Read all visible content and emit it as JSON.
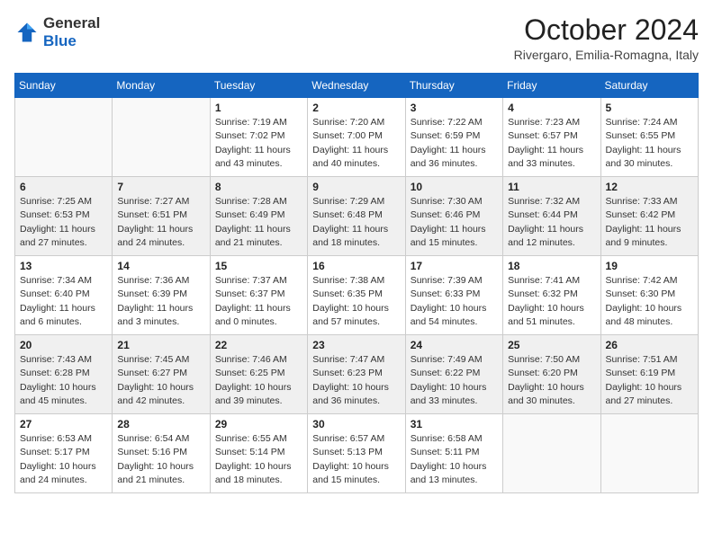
{
  "header": {
    "logo_general": "General",
    "logo_blue": "Blue",
    "month": "October 2024",
    "location": "Rivergaro, Emilia-Romagna, Italy"
  },
  "weekdays": [
    "Sunday",
    "Monday",
    "Tuesday",
    "Wednesday",
    "Thursday",
    "Friday",
    "Saturday"
  ],
  "weeks": [
    [
      {
        "day": "",
        "info": ""
      },
      {
        "day": "",
        "info": ""
      },
      {
        "day": "1",
        "info": "Sunrise: 7:19 AM\nSunset: 7:02 PM\nDaylight: 11 hours and 43 minutes."
      },
      {
        "day": "2",
        "info": "Sunrise: 7:20 AM\nSunset: 7:00 PM\nDaylight: 11 hours and 40 minutes."
      },
      {
        "day": "3",
        "info": "Sunrise: 7:22 AM\nSunset: 6:59 PM\nDaylight: 11 hours and 36 minutes."
      },
      {
        "day": "4",
        "info": "Sunrise: 7:23 AM\nSunset: 6:57 PM\nDaylight: 11 hours and 33 minutes."
      },
      {
        "day": "5",
        "info": "Sunrise: 7:24 AM\nSunset: 6:55 PM\nDaylight: 11 hours and 30 minutes."
      }
    ],
    [
      {
        "day": "6",
        "info": "Sunrise: 7:25 AM\nSunset: 6:53 PM\nDaylight: 11 hours and 27 minutes."
      },
      {
        "day": "7",
        "info": "Sunrise: 7:27 AM\nSunset: 6:51 PM\nDaylight: 11 hours and 24 minutes."
      },
      {
        "day": "8",
        "info": "Sunrise: 7:28 AM\nSunset: 6:49 PM\nDaylight: 11 hours and 21 minutes."
      },
      {
        "day": "9",
        "info": "Sunrise: 7:29 AM\nSunset: 6:48 PM\nDaylight: 11 hours and 18 minutes."
      },
      {
        "day": "10",
        "info": "Sunrise: 7:30 AM\nSunset: 6:46 PM\nDaylight: 11 hours and 15 minutes."
      },
      {
        "day": "11",
        "info": "Sunrise: 7:32 AM\nSunset: 6:44 PM\nDaylight: 11 hours and 12 minutes."
      },
      {
        "day": "12",
        "info": "Sunrise: 7:33 AM\nSunset: 6:42 PM\nDaylight: 11 hours and 9 minutes."
      }
    ],
    [
      {
        "day": "13",
        "info": "Sunrise: 7:34 AM\nSunset: 6:40 PM\nDaylight: 11 hours and 6 minutes."
      },
      {
        "day": "14",
        "info": "Sunrise: 7:36 AM\nSunset: 6:39 PM\nDaylight: 11 hours and 3 minutes."
      },
      {
        "day": "15",
        "info": "Sunrise: 7:37 AM\nSunset: 6:37 PM\nDaylight: 11 hours and 0 minutes."
      },
      {
        "day": "16",
        "info": "Sunrise: 7:38 AM\nSunset: 6:35 PM\nDaylight: 10 hours and 57 minutes."
      },
      {
        "day": "17",
        "info": "Sunrise: 7:39 AM\nSunset: 6:33 PM\nDaylight: 10 hours and 54 minutes."
      },
      {
        "day": "18",
        "info": "Sunrise: 7:41 AM\nSunset: 6:32 PM\nDaylight: 10 hours and 51 minutes."
      },
      {
        "day": "19",
        "info": "Sunrise: 7:42 AM\nSunset: 6:30 PM\nDaylight: 10 hours and 48 minutes."
      }
    ],
    [
      {
        "day": "20",
        "info": "Sunrise: 7:43 AM\nSunset: 6:28 PM\nDaylight: 10 hours and 45 minutes."
      },
      {
        "day": "21",
        "info": "Sunrise: 7:45 AM\nSunset: 6:27 PM\nDaylight: 10 hours and 42 minutes."
      },
      {
        "day": "22",
        "info": "Sunrise: 7:46 AM\nSunset: 6:25 PM\nDaylight: 10 hours and 39 minutes."
      },
      {
        "day": "23",
        "info": "Sunrise: 7:47 AM\nSunset: 6:23 PM\nDaylight: 10 hours and 36 minutes."
      },
      {
        "day": "24",
        "info": "Sunrise: 7:49 AM\nSunset: 6:22 PM\nDaylight: 10 hours and 33 minutes."
      },
      {
        "day": "25",
        "info": "Sunrise: 7:50 AM\nSunset: 6:20 PM\nDaylight: 10 hours and 30 minutes."
      },
      {
        "day": "26",
        "info": "Sunrise: 7:51 AM\nSunset: 6:19 PM\nDaylight: 10 hours and 27 minutes."
      }
    ],
    [
      {
        "day": "27",
        "info": "Sunrise: 6:53 AM\nSunset: 5:17 PM\nDaylight: 10 hours and 24 minutes."
      },
      {
        "day": "28",
        "info": "Sunrise: 6:54 AM\nSunset: 5:16 PM\nDaylight: 10 hours and 21 minutes."
      },
      {
        "day": "29",
        "info": "Sunrise: 6:55 AM\nSunset: 5:14 PM\nDaylight: 10 hours and 18 minutes."
      },
      {
        "day": "30",
        "info": "Sunrise: 6:57 AM\nSunset: 5:13 PM\nDaylight: 10 hours and 15 minutes."
      },
      {
        "day": "31",
        "info": "Sunrise: 6:58 AM\nSunset: 5:11 PM\nDaylight: 10 hours and 13 minutes."
      },
      {
        "day": "",
        "info": ""
      },
      {
        "day": "",
        "info": ""
      }
    ]
  ]
}
